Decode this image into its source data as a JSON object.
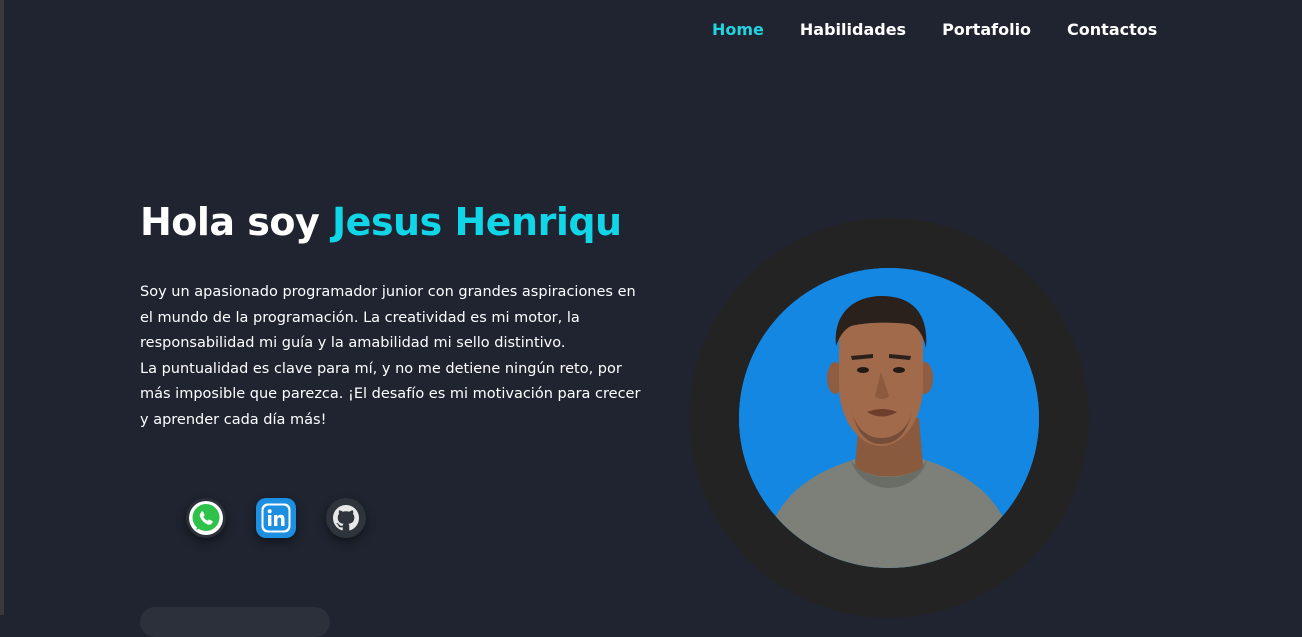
{
  "nav": {
    "items": [
      "Home",
      "Habilidades",
      "Portafolio",
      "Contactos"
    ],
    "active_color": "#22d3e0"
  },
  "hero": {
    "greeting": "Hola soy ",
    "name": "Jesus Henriqu",
    "bio_paragraph_1": "Soy un apasionado programador junior con grandes aspiraciones en el mundo de la programación. La creatividad es mi motor, la responsabilidad mi guía y la amabilidad mi sello distintivo.",
    "bio_paragraph_2": "La puntualidad es clave para mí, y no me detiene ningún reto, por más imposible que parezca. ¡El desafío es mi motivación para crecer y aprender cada día más!"
  },
  "socials": [
    {
      "icon": "whatsapp-icon"
    },
    {
      "icon": "linkedin-icon"
    },
    {
      "icon": "github-icon"
    }
  ],
  "colors": {
    "background": "#1f2430",
    "accent": "#10d6e8",
    "photo_background": "#1487e3",
    "photo_ring": "#232323"
  }
}
